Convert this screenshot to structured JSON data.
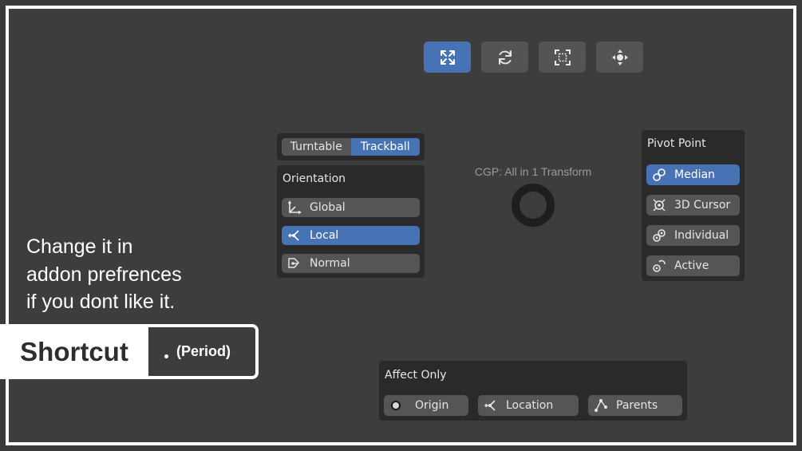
{
  "toolbar": {
    "buttons": [
      {
        "name": "scale-tool",
        "icon": "arrows-expand-icon",
        "active": true
      },
      {
        "name": "rotate-tool",
        "icon": "rotate-icon",
        "active": false
      },
      {
        "name": "frame-tool",
        "icon": "frame-select-icon",
        "active": false
      },
      {
        "name": "move-tool",
        "icon": "move-arrows-icon",
        "active": false
      }
    ]
  },
  "view_mode": {
    "options": [
      {
        "label": "Turntable",
        "active": false
      },
      {
        "label": "Trackball",
        "active": true
      }
    ]
  },
  "orientation": {
    "title": "Orientation",
    "options": [
      {
        "label": "Global",
        "icon": "global-axes-icon",
        "active": false
      },
      {
        "label": "Local",
        "icon": "local-axes-icon",
        "active": true
      },
      {
        "label": "Normal",
        "icon": "normal-icon",
        "active": false
      }
    ]
  },
  "center": {
    "title": "CGP: All in 1 Transform"
  },
  "pivot_point": {
    "title": "Pivot Point",
    "options": [
      {
        "label": "Median",
        "icon": "median-icon",
        "active": true
      },
      {
        "label": "3D Cursor",
        "icon": "cursor-3d-icon",
        "active": false
      },
      {
        "label": "Individual",
        "icon": "individual-origins-icon",
        "active": false
      },
      {
        "label": "Active",
        "icon": "active-element-icon",
        "active": false
      }
    ]
  },
  "affect_only": {
    "title": "Affect Only",
    "options": [
      {
        "label": "Origin",
        "icon": "radio-icon"
      },
      {
        "label": "Location",
        "icon": "location-icon"
      },
      {
        "label": "Parents",
        "icon": "parents-icon"
      }
    ]
  },
  "note": {
    "lines": [
      "Change it in",
      "addon prefrences",
      "if you dont like it."
    ]
  },
  "shortcut": {
    "label": "Shortcut",
    "key": "(Period)"
  },
  "colors": {
    "accent": "#4772b3",
    "background": "#3d3d3d",
    "panel": "#2a2a2a",
    "button": "#555555"
  }
}
